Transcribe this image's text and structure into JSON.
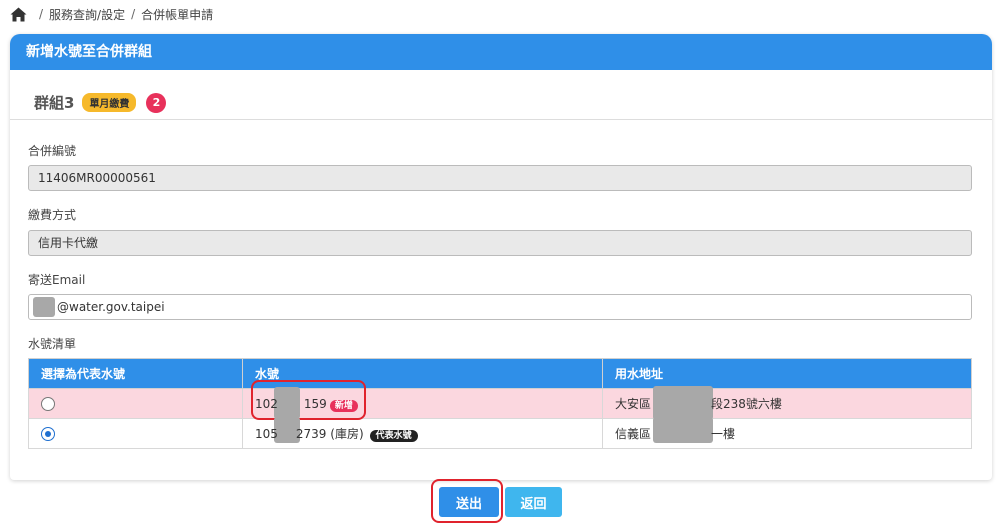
{
  "breadcrumb": {
    "items": [
      "服務查詢/設定",
      "合併帳單申請"
    ]
  },
  "panel": {
    "title": "新增水號至合併群組"
  },
  "group": {
    "name": "群組3",
    "billing_badge": "單月繳費",
    "count": "2"
  },
  "form": {
    "merge_number": {
      "label": "合併編號",
      "value": "11406MR00000561"
    },
    "payment_method": {
      "label": "繳費方式",
      "value": "信用卡代繳"
    },
    "email": {
      "label": "寄送Email",
      "value_suffix": "@water.gov.taipei"
    }
  },
  "water_list": {
    "label": "水號清單",
    "columns": [
      "選擇為代表水號",
      "水號",
      "用水地址"
    ],
    "rows": [
      {
        "selected": false,
        "number_prefix": "102",
        "number_suffix": "159",
        "tag": "新增",
        "addr_prefix": "大安區",
        "addr_suffix": "段238號六樓"
      },
      {
        "selected": true,
        "number_prefix": "105",
        "number_suffix": "2739 (庫房)",
        "tag": "代表水號",
        "addr_prefix": "信義區",
        "addr_suffix": "一樓"
      }
    ]
  },
  "actions": {
    "submit": "送出",
    "back": "返回"
  },
  "colors": {
    "primary": "#2f8fe8",
    "accent_red": "#e8315b",
    "badge_yellow": "#f6b92b",
    "back_button": "#3fb6ee"
  },
  "icons": {
    "home": "home-icon"
  }
}
